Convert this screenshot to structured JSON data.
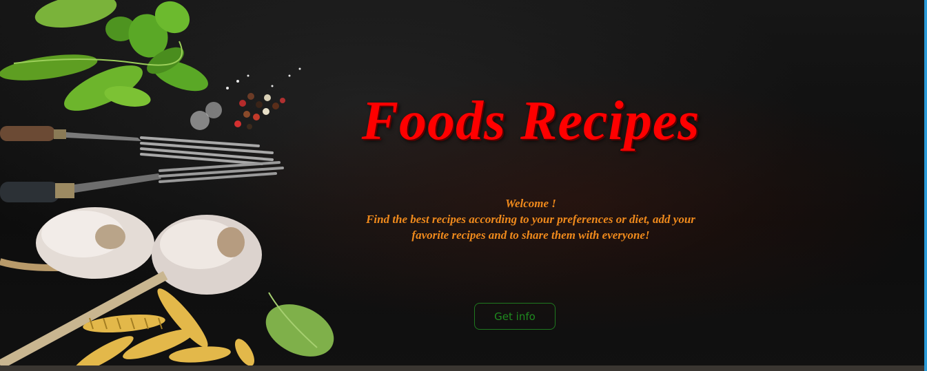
{
  "hero": {
    "title": "Foods Recipes",
    "welcome_line1": "Welcome !",
    "welcome_line2": "Find the best recipes according to your preferences or diet, add your",
    "welcome_line3": "favorite recipes and to share them with everyone!",
    "button_label": "Get info"
  },
  "colors": {
    "title": "#ff0000",
    "subtitle": "#f08a1c",
    "button": "#1f8a1f",
    "scrollbar": "#2b9bd8"
  },
  "icons": {
    "background": "food-ingredients-image"
  }
}
